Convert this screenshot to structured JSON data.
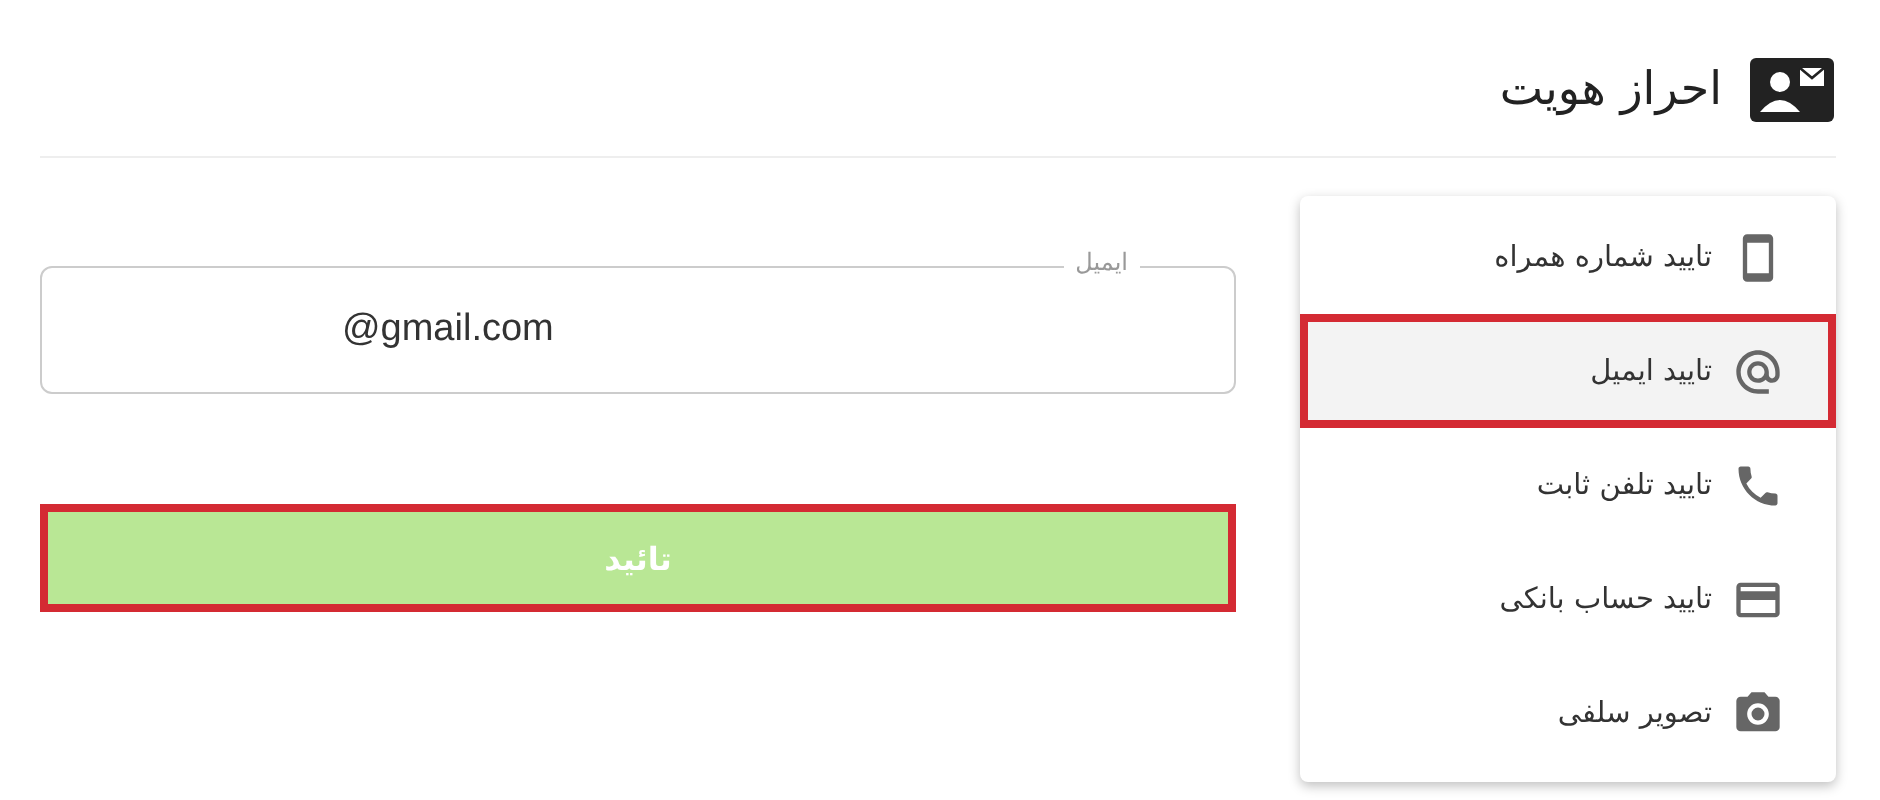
{
  "header": {
    "title": "احراز هویت"
  },
  "menu": [
    {
      "label": "تایید شماره همراه",
      "kind": "phone",
      "selected": false
    },
    {
      "label": "تایید ایمیل",
      "kind": "email",
      "selected": true
    },
    {
      "label": "تایید تلفن ثابت",
      "kind": "landline",
      "selected": false
    },
    {
      "label": "تایید حساب بانکی",
      "kind": "card",
      "selected": false
    },
    {
      "label": "تصویر سلفی",
      "kind": "camera",
      "selected": false
    }
  ],
  "email_field": {
    "label": "ایمیل",
    "value": "@gmail.com"
  },
  "submit_button": {
    "label": "تائید",
    "highlighted": true
  }
}
